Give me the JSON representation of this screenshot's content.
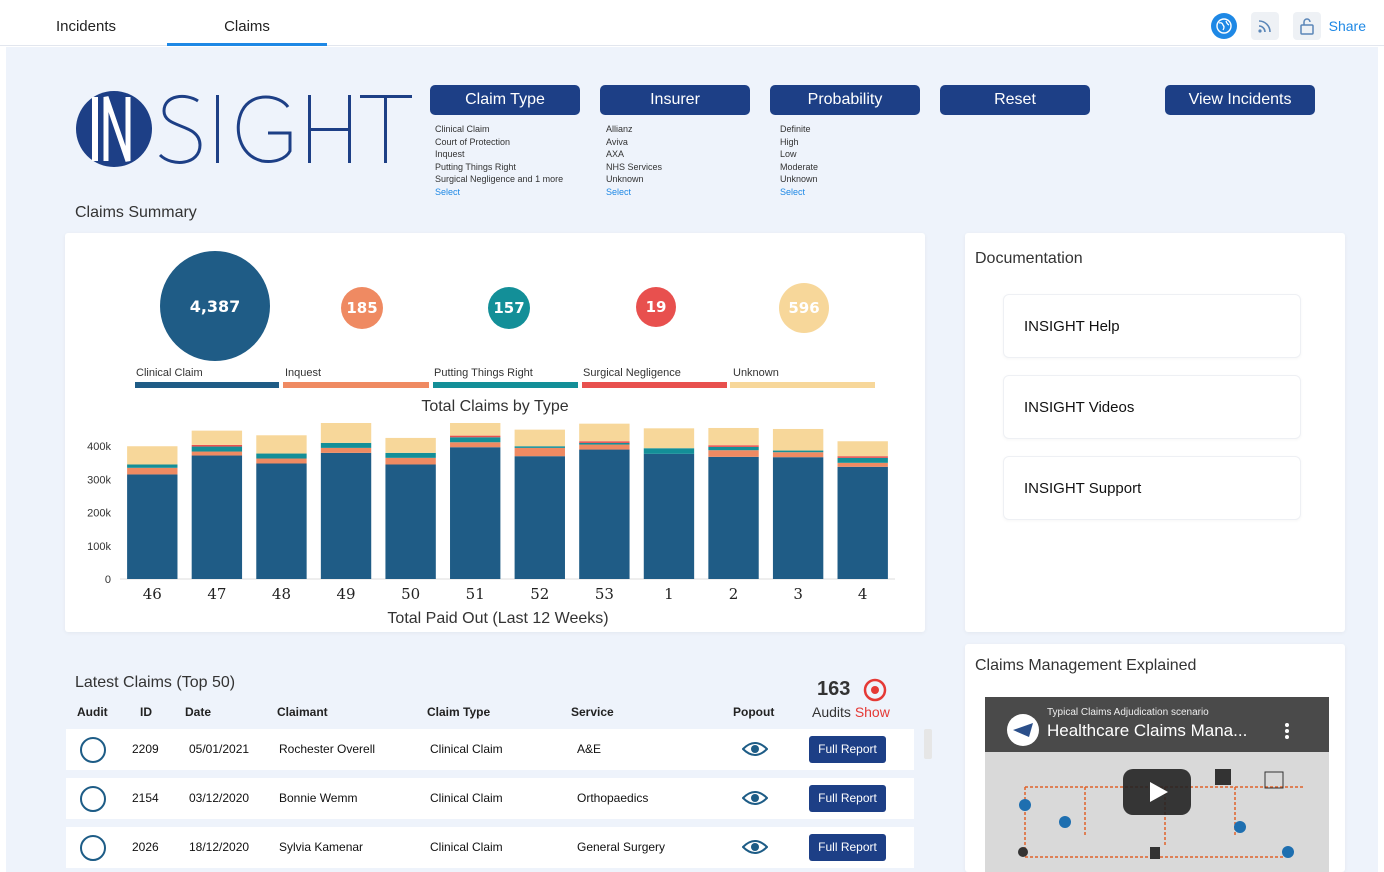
{
  "nav": {
    "tabs": [
      {
        "label": "Incidents"
      },
      {
        "label": "Claims"
      }
    ],
    "share_label": "Share"
  },
  "filters": {
    "claim_type": {
      "label": "Claim Type",
      "options": [
        "Clinical Claim",
        "Court of Protection",
        "Inquest",
        "Putting Things Right",
        "Surgical Negligence and 1 more"
      ],
      "select": "Select"
    },
    "insurer": {
      "label": "Insurer",
      "options": [
        "Allianz",
        "Aviva",
        "AXA",
        "NHS Services",
        "Unknown"
      ],
      "select": "Select"
    },
    "probability": {
      "label": "Probability",
      "options": [
        "Definite",
        "High",
        "Low",
        "Moderate",
        "Unknown"
      ],
      "select": "Select"
    },
    "reset_label": "Reset",
    "view_incidents_label": "View Incidents"
  },
  "claims_summary": {
    "title": "Claims Summary",
    "bubbles": [
      {
        "value": "4,387",
        "label": "Clinical Claim",
        "color": "#1f5c86"
      },
      {
        "value": "185",
        "label": "Inquest",
        "color": "#ef8a62"
      },
      {
        "value": "157",
        "label": "Putting Things Right",
        "color": "#138f98"
      },
      {
        "value": "19",
        "label": "Surgical Negligence",
        "color": "#e8504e"
      },
      {
        "value": "596",
        "label": "Unknown",
        "color": "#f7d79a"
      }
    ],
    "bubbles_title": "Total Claims by Type"
  },
  "chart_data": {
    "type": "bar",
    "stacked": true,
    "xlabel": "Total Paid Out (Last 12 Weeks)",
    "ylim": [
      0,
      470000
    ],
    "yticks": [
      0,
      100000,
      200000,
      300000,
      400000
    ],
    "ytick_labels": [
      "0",
      "100k",
      "200k",
      "300k",
      "400k"
    ],
    "categories": [
      "46",
      "47",
      "48",
      "49",
      "50",
      "51",
      "52",
      "53",
      "1",
      "2",
      "3",
      "4"
    ],
    "series": [
      {
        "color": "#1f5c86",
        "values": [
          315000,
          372000,
          348000,
          380000,
          345000,
          397000,
          370000,
          390000,
          377000,
          368000,
          367000,
          338000
        ]
      },
      {
        "color": "#ef8a62",
        "values": [
          20000,
          12000,
          15000,
          15000,
          20000,
          15000,
          25000,
          15000,
          0,
          20000,
          15000,
          12000
        ]
      },
      {
        "color": "#138f98",
        "values": [
          10000,
          15000,
          15000,
          15000,
          15000,
          15000,
          5000,
          5000,
          17000,
          10000,
          5000,
          15000
        ]
      },
      {
        "color": "#e8504e",
        "values": [
          0,
          5000,
          0,
          0,
          0,
          5000,
          0,
          5000,
          0,
          5000,
          0,
          5000
        ]
      },
      {
        "color": "#f7d79a",
        "values": [
          55000,
          43000,
          55000,
          60000,
          45000,
          50000,
          50000,
          53000,
          60000,
          52000,
          65000,
          45000
        ]
      }
    ]
  },
  "documentation": {
    "title": "Documentation",
    "items": [
      {
        "label": "INSIGHT Help"
      },
      {
        "label": "INSIGHT Videos"
      },
      {
        "label": "INSIGHT Support"
      }
    ]
  },
  "latest_claims": {
    "title": "Latest Claims (Top 50)",
    "headers": [
      "Audit",
      "ID",
      "Date",
      "Claimant",
      "Claim Type",
      "Service",
      "Popout"
    ],
    "audits_count": "163",
    "audits_label": "Audits",
    "audits_show": "Show",
    "rows": [
      {
        "id": "2209",
        "date": "05/01/2021",
        "claimant": "Rochester Overell",
        "claim_type": "Clinical Claim",
        "service": "A&E",
        "report": "Full Report"
      },
      {
        "id": "2154",
        "date": "03/12/2020",
        "claimant": "Bonnie Wemm",
        "claim_type": "Clinical Claim",
        "service": "Orthopaedics",
        "report": "Full Report"
      },
      {
        "id": "2026",
        "date": "18/12/2020",
        "claimant": "Sylvia Kamenar",
        "claim_type": "Clinical Claim",
        "service": "General Surgery",
        "report": "Full Report"
      }
    ]
  },
  "explained": {
    "title": "Claims Management Explained",
    "video_title": "Healthcare Claims Mana...",
    "video_subtitle": "Typical Claims Adjudication scenario"
  }
}
